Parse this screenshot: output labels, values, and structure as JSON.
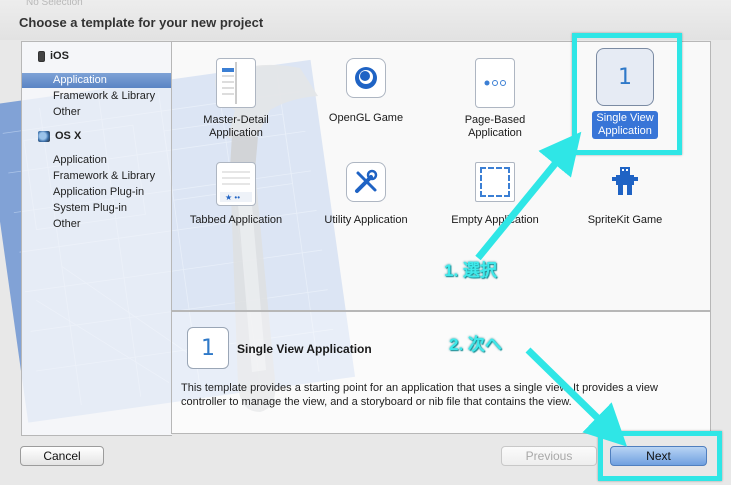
{
  "window": {
    "faded_title": "No Selection",
    "heading": "Choose a template for your new project"
  },
  "sidebar": {
    "groups": [
      {
        "label": "iOS",
        "icon": "iphone-icon",
        "items": [
          {
            "label": "Application",
            "selected": true
          },
          {
            "label": "Framework & Library"
          },
          {
            "label": "Other"
          }
        ]
      },
      {
        "label": "OS X",
        "icon": "osx-icon",
        "items": [
          {
            "label": "Application"
          },
          {
            "label": "Framework & Library"
          },
          {
            "label": "Application Plug-in"
          },
          {
            "label": "System Plug-in"
          },
          {
            "label": "Other"
          }
        ]
      }
    ]
  },
  "templates": [
    {
      "label": "Master-Detail\nApplication",
      "icon": "master-detail-icon"
    },
    {
      "label": "OpenGL Game",
      "icon": "opengl-game-icon"
    },
    {
      "label": "Page-Based\nApplication",
      "icon": "page-based-icon"
    },
    {
      "label": "Single View\nApplication",
      "icon": "single-view-icon",
      "icon_text": "1",
      "selected": true
    },
    {
      "label": "Tabbed Application",
      "icon": "tabbed-icon"
    },
    {
      "label": "Utility Application",
      "icon": "utility-icon"
    },
    {
      "label": "Empty Application",
      "icon": "empty-app-icon"
    },
    {
      "label": "SpriteKit Game",
      "icon": "spritekit-icon"
    }
  ],
  "description": {
    "icon_text": "1",
    "title": "Single View Application",
    "text": "This template provides a starting point for an application that uses a single view. It provides a view controller to manage the view, and a storyboard or nib file that contains the view."
  },
  "buttons": {
    "cancel": "Cancel",
    "previous": "Previous",
    "next": "Next"
  },
  "annotations": {
    "step1": "1. 選択",
    "step2": "2. 次へ"
  },
  "colors": {
    "highlight": "#2fe6e6",
    "selection": "#3875d7",
    "sidebar_selection": "#6b93cd"
  }
}
